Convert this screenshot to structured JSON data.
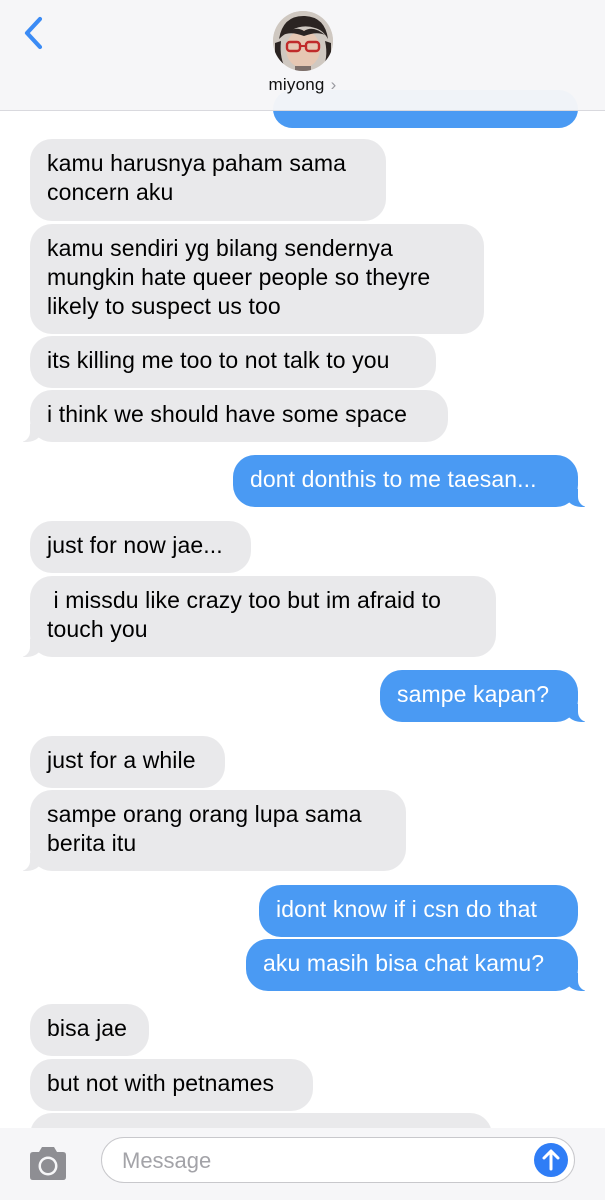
{
  "header": {
    "contact_name": "miyong",
    "back_icon": "chevron-left-icon",
    "name_chevron": "›"
  },
  "messages": [
    {
      "from": "me",
      "lines": [
        ""
      ]
    },
    {
      "from": "them",
      "lines": [
        "kamu harusnya paham sama",
        "concern aku"
      ]
    },
    {
      "from": "them",
      "lines": [
        "kamu sendiri yg bilang sendernya",
        "mungkin hate queer people so theyre",
        "likely to suspect us too"
      ]
    },
    {
      "from": "them",
      "lines": [
        "its killing me too to not talk to you"
      ]
    },
    {
      "from": "them",
      "lines": [
        "i think we should have some space"
      ]
    },
    {
      "from": "me",
      "lines": [
        "dont donthis to me taesan..."
      ]
    },
    {
      "from": "them",
      "lines": [
        "just for now jae..."
      ]
    },
    {
      "from": "them",
      "lines": [
        " i missdu like crazy too but im afraid to",
        "touch you"
      ]
    },
    {
      "from": "me",
      "lines": [
        "sampe kapan?"
      ]
    },
    {
      "from": "them",
      "lines": [
        "just for a while"
      ]
    },
    {
      "from": "them",
      "lines": [
        "sampe orang orang lupa sama",
        "berita itu"
      ]
    },
    {
      "from": "me",
      "lines": [
        "idont know if i csn do that"
      ]
    },
    {
      "from": "me",
      "lines": [
        "aku masih bisa chat kamu?"
      ]
    },
    {
      "from": "them",
      "lines": [
        "bisa jae"
      ]
    },
    {
      "from": "them",
      "lines": [
        "but not with petnames"
      ]
    },
    {
      "from": "them",
      "lines": [
        ""
      ]
    }
  ],
  "composer": {
    "placeholder": "Message",
    "camera_icon": "camera-icon",
    "send_icon": "send-arrow-icon"
  },
  "colors": {
    "incoming_bubble": "#e9e9eb",
    "outgoing_bubble": "#4a9af3",
    "send_button": "#2f7df6",
    "header_bg": "#f6f6f8"
  }
}
